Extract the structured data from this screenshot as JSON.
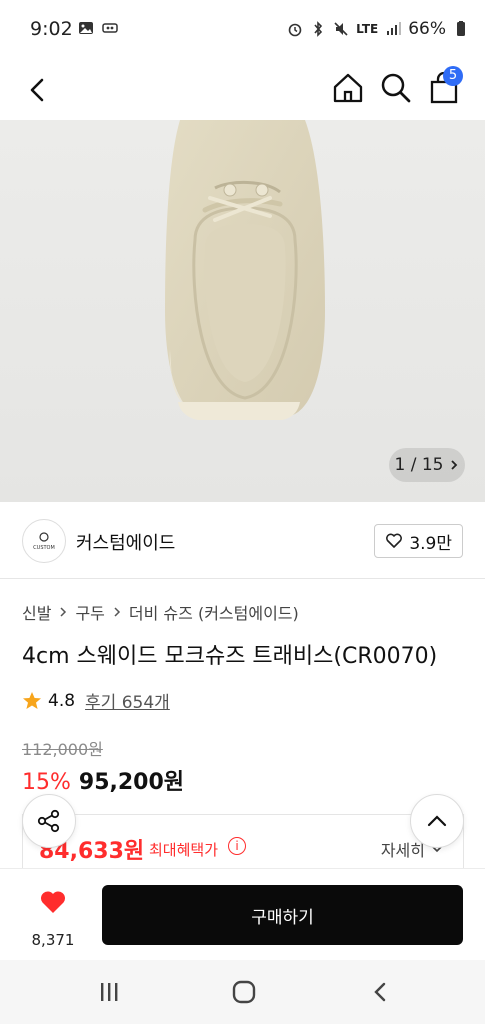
{
  "status_bar": {
    "time": "9:02",
    "battery": "66%",
    "network": "LTE"
  },
  "header": {
    "cart_count": "5"
  },
  "gallery": {
    "counter": "1 / 15"
  },
  "brand": {
    "logo_text": "CUSTOM",
    "name": "커스텀에이드",
    "likes": "3.9만"
  },
  "breadcrumb": [
    "신발",
    "구두",
    "더비 슈즈 (커스텀에이드)"
  ],
  "product": {
    "title": "4cm 스웨이드 모크슈즈 트래비스(CR0070)",
    "rating": "4.8",
    "review_link": "후기 654개",
    "original_price": "112,000원",
    "discount": "15%",
    "sale_price": "95,200원"
  },
  "benefit": {
    "price": "84,633원",
    "label": "최대혜택가",
    "detail": "자세히"
  },
  "purchase_bar": {
    "wish_count": "8,371",
    "buy_label": "구매하기"
  },
  "colors": {
    "accent_red": "#ff2d2d",
    "badge_blue": "#2f6cf6",
    "buy_black": "#0a0a0a",
    "star": "#f7a51c"
  },
  "icons": [
    "back-icon",
    "home-icon",
    "search-icon",
    "shopping-bag-icon",
    "heart-outline-icon",
    "star-icon",
    "share-icon",
    "chevron-up-icon",
    "heart-filled-icon",
    "info-icon",
    "chevron-down-icon",
    "recent-apps-icon",
    "home-circle-icon",
    "nav-back-icon"
  ]
}
